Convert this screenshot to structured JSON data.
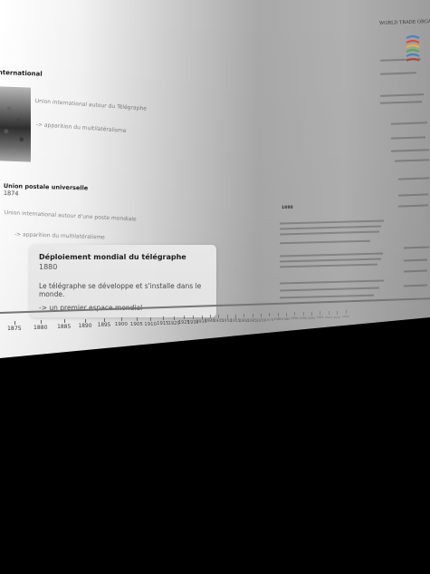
{
  "timeline": {
    "section_title": "nternational",
    "items": [
      {
        "title": "Union international autour du Télégraphe",
        "link": "-> apparition du multilatéralisme"
      },
      {
        "title": "Union postale universelle",
        "year": "1874",
        "description": "Union international autour d'une poste mondiale",
        "link": "-> apparition du multilatéralisme"
      }
    ],
    "highlight": {
      "title": "Déploiement mondial du télégraphe",
      "year": "1880",
      "description": "Le télégraphe se développe et s'installe dans le monde.",
      "link": "-> un premier espace mondial"
    },
    "axis_labels": [
      "1875",
      "1880",
      "1885",
      "1890",
      "1895",
      "1900",
      "1905",
      "1910",
      "1915",
      "1920",
      "1925",
      "1930",
      "1935",
      "1940",
      "1945",
      "1950",
      "1955",
      "1960",
      "1965",
      "1970",
      "1975",
      "1980",
      "1985",
      "1990",
      "1995",
      "2000",
      "2005",
      "2010",
      "2015",
      "2020"
    ]
  },
  "document": {
    "logo_text": "WORLD TRADE ORGANIZATION",
    "section_year": "1880"
  }
}
